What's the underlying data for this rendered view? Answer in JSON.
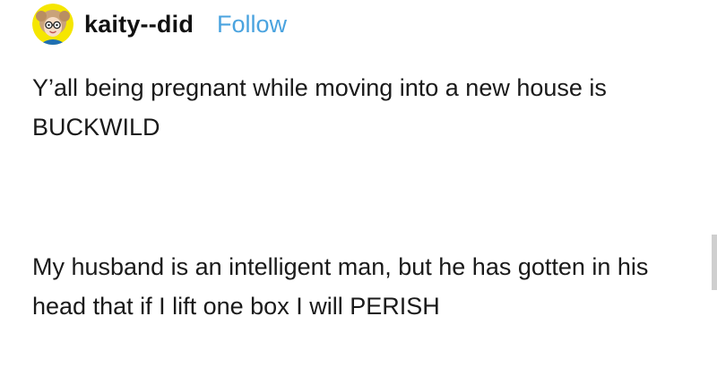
{
  "post": {
    "author": {
      "username": "kaity--did",
      "avatar_icon": "cartoon-girl-avatar-icon",
      "follow_label": "Follow"
    },
    "paragraphs": [
      "Y’all being pregnant while moving into a new house is BUCKWILD",
      "My husband is an intelligent man, but he has gotten in his head that if I lift one box I will PERISH"
    ]
  },
  "colors": {
    "follow": "#4aa3df",
    "text": "#1a1a1a",
    "avatar_bg": "#f5e600"
  }
}
